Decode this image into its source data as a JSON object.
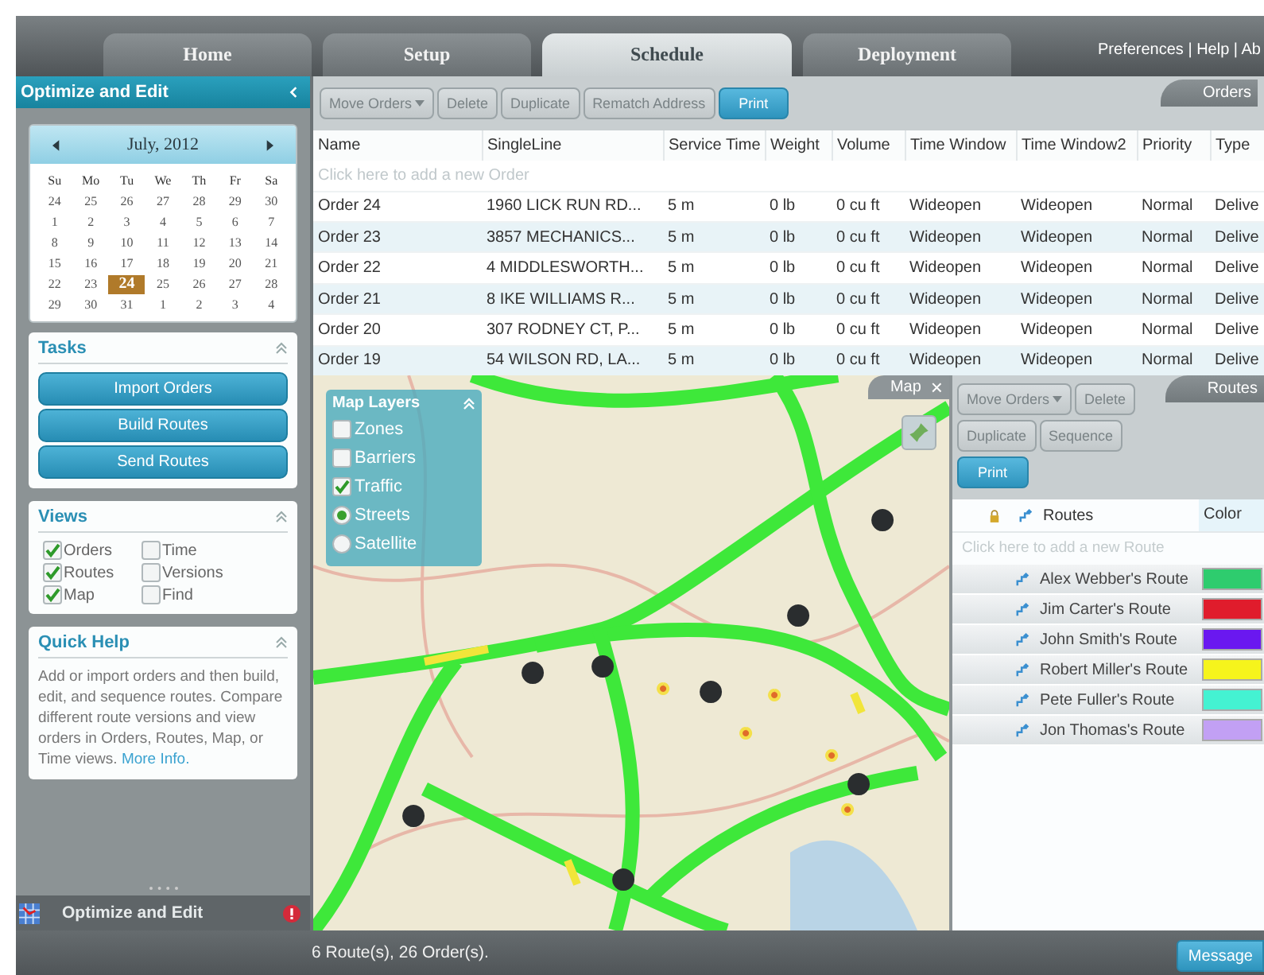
{
  "tabs": [
    {
      "label": "Home",
      "selected": false
    },
    {
      "label": "Setup",
      "selected": false
    },
    {
      "label": "Schedule",
      "selected": true
    },
    {
      "label": "Deployment",
      "selected": false
    }
  ],
  "header_links": "Preferences | Help | Ab",
  "sidebar": {
    "title": "Optimize and Edit",
    "calendar": {
      "month": "July, 2012",
      "weekdays": [
        "Su",
        "Mo",
        "Tu",
        "We",
        "Th",
        "Fr",
        "Sa"
      ],
      "weeks": [
        [
          {
            "d": "24",
            "selected": false
          },
          {
            "d": "25",
            "selected": false
          },
          {
            "d": "26",
            "selected": false
          },
          {
            "d": "27",
            "selected": false
          },
          {
            "d": "28",
            "selected": false
          },
          {
            "d": "29",
            "selected": false
          },
          {
            "d": "30",
            "selected": false
          }
        ],
        [
          {
            "d": "1",
            "selected": false
          },
          {
            "d": "2",
            "selected": false
          },
          {
            "d": "3",
            "selected": false
          },
          {
            "d": "4",
            "selected": false
          },
          {
            "d": "5",
            "selected": false
          },
          {
            "d": "6",
            "selected": false
          },
          {
            "d": "7",
            "selected": false
          }
        ],
        [
          {
            "d": "8",
            "selected": false
          },
          {
            "d": "9",
            "selected": false
          },
          {
            "d": "10",
            "selected": false
          },
          {
            "d": "11",
            "selected": false
          },
          {
            "d": "12",
            "selected": false
          },
          {
            "d": "13",
            "selected": false
          },
          {
            "d": "14",
            "selected": false
          }
        ],
        [
          {
            "d": "15",
            "selected": false
          },
          {
            "d": "16",
            "selected": false
          },
          {
            "d": "17",
            "selected": false
          },
          {
            "d": "18",
            "selected": false
          },
          {
            "d": "19",
            "selected": false
          },
          {
            "d": "20",
            "selected": false
          },
          {
            "d": "21",
            "selected": false
          }
        ],
        [
          {
            "d": "22",
            "selected": false
          },
          {
            "d": "23",
            "selected": false
          },
          {
            "d": "24",
            "selected": true
          },
          {
            "d": "25",
            "selected": false
          },
          {
            "d": "26",
            "selected": false
          },
          {
            "d": "27",
            "selected": false
          },
          {
            "d": "28",
            "selected": false
          }
        ],
        [
          {
            "d": "29",
            "selected": false
          },
          {
            "d": "30",
            "selected": false
          },
          {
            "d": "31",
            "selected": false
          },
          {
            "d": "1",
            "selected": false
          },
          {
            "d": "2",
            "selected": false
          },
          {
            "d": "3",
            "selected": false
          },
          {
            "d": "4",
            "selected": false
          }
        ]
      ]
    },
    "tasks": {
      "title": "Tasks",
      "buttons": [
        "Import Orders",
        "Build Routes",
        "Send Routes"
      ]
    },
    "views": {
      "title": "Views",
      "items": [
        {
          "label": "Orders",
          "checked": true
        },
        {
          "label": "Time",
          "checked": false
        },
        {
          "label": "Routes",
          "checked": true
        },
        {
          "label": "Versions",
          "checked": false
        },
        {
          "label": "Map",
          "checked": true
        },
        {
          "label": "Find",
          "checked": false
        }
      ]
    },
    "quick_help": {
      "title": "Quick Help",
      "text": "Add or import orders and then build, edit, and sequence routes.  Compare different route versions and view orders in Orders, Routes, Map, or Time views.",
      "link": "More Info."
    },
    "footer": {
      "title": "Optimize and Edit"
    }
  },
  "orders": {
    "tab": "Orders",
    "toolbar": [
      {
        "label": "Move Orders",
        "kind": "menu"
      },
      {
        "label": "Delete",
        "kind": "plain"
      },
      {
        "label": "Duplicate",
        "kind": "plain"
      },
      {
        "label": "Rematch Address",
        "kind": "plain"
      },
      {
        "label": "Print",
        "kind": "primary"
      }
    ],
    "columns": [
      "Name",
      "SingleLine",
      "Service Time",
      "Weight",
      "Volume",
      "Time Window",
      "Time Window2",
      "Priority",
      "Type"
    ],
    "new_row_hint": "Click here to add a new Order",
    "rows": [
      [
        "Order 24",
        "1960 LICK RUN RD...",
        "5 m",
        "0 lb",
        "0 cu ft",
        "Wideopen",
        "Wideopen",
        "Normal",
        "Delive"
      ],
      [
        "Order 23",
        "3857 MECHANICS...",
        "5 m",
        "0 lb",
        "0 cu ft",
        "Wideopen",
        "Wideopen",
        "Normal",
        "Delive"
      ],
      [
        "Order 22",
        "4 MIDDLESWORTH...",
        "5 m",
        "0 lb",
        "0 cu ft",
        "Wideopen",
        "Wideopen",
        "Normal",
        "Delive"
      ],
      [
        "Order 21",
        "8 IKE WILLIAMS R...",
        "5 m",
        "0 lb",
        "0 cu ft",
        "Wideopen",
        "Wideopen",
        "Normal",
        "Delive"
      ],
      [
        "Order 20",
        "307 RODNEY CT, P...",
        "5 m",
        "0 lb",
        "0 cu ft",
        "Wideopen",
        "Wideopen",
        "Normal",
        "Delive"
      ],
      [
        "Order 19",
        "54 WILSON RD, LA...",
        "5 m",
        "0 lb",
        "0 cu ft",
        "Wideopen",
        "Wideopen",
        "Normal",
        "Delive"
      ]
    ]
  },
  "map": {
    "title": "Map",
    "close": "×",
    "layers": {
      "title": "Map Layers",
      "items": [
        {
          "label": "Zones",
          "kind": "checkbox",
          "checked": false
        },
        {
          "label": "Barriers",
          "kind": "checkbox",
          "checked": false
        },
        {
          "label": "Traffic",
          "kind": "checkbox",
          "checked": true
        },
        {
          "label": "Streets",
          "kind": "radio",
          "selected": true
        },
        {
          "label": "Satellite",
          "kind": "radio",
          "selected": false
        }
      ]
    }
  },
  "routes": {
    "tab": "Routes",
    "toolbar": [
      {
        "label": "Move Orders",
        "kind": "menu"
      },
      {
        "label": "Delete",
        "kind": "plain"
      },
      {
        "label": "Duplicate",
        "kind": "plain"
      },
      {
        "label": "Sequence",
        "kind": "plain"
      },
      {
        "label": "Print",
        "kind": "primary"
      }
    ],
    "columns": [
      "Routes",
      "Color"
    ],
    "new_row_hint": "Click here to add a new Route",
    "rows": [
      {
        "name": "Alex Webber's Route",
        "color": "#2ecc6e"
      },
      {
        "name": "Jim Carter's Route",
        "color": "#e01c2c"
      },
      {
        "name": "John Smith's Route",
        "color": "#6a18f0"
      },
      {
        "name": "Robert Miller's Route",
        "color": "#f6f41c"
      },
      {
        "name": "Pete Fuller's Route",
        "color": "#44f2d2"
      },
      {
        "name": "Jon Thomas's Route",
        "color": "#c2a0f4"
      }
    ]
  },
  "status_bar": {
    "text": "6 Route(s), 26 Order(s).",
    "button": "Message"
  }
}
